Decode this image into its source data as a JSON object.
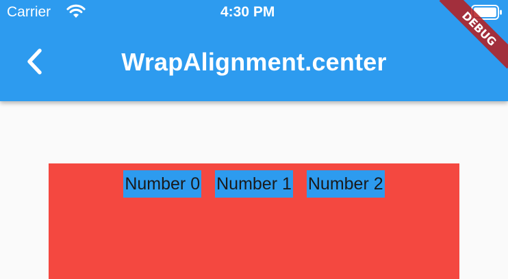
{
  "status_bar": {
    "carrier": "Carrier",
    "time": "4:30 PM",
    "wifi_icon": "wifi-icon",
    "battery_icon": "battery-icon"
  },
  "app_bar": {
    "title": "WrapAlignment.center",
    "back_icon": "chevron-left-icon",
    "background_color": "#2d9bef"
  },
  "debug_banner": {
    "label": "DEBUG",
    "color": "#b71c1c"
  },
  "wrap": {
    "alignment": "center",
    "background_color": "#f44840",
    "chip_color": "#2d9bef",
    "items": [
      {
        "label": "Number 0"
      },
      {
        "label": "Number 1"
      },
      {
        "label": "Number 2"
      }
    ]
  }
}
